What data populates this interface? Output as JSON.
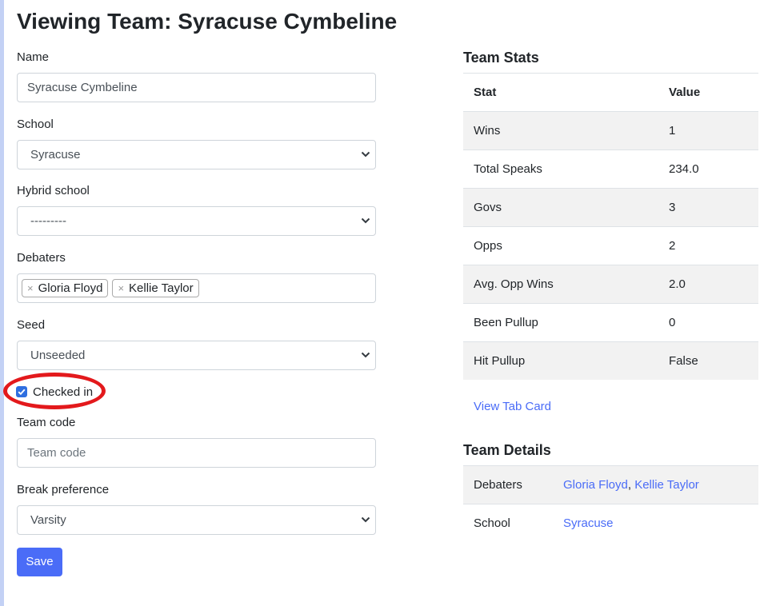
{
  "page": {
    "title": "Viewing Team: Syracuse Cymbeline"
  },
  "form": {
    "name": {
      "label": "Name",
      "value": "Syracuse Cymbeline"
    },
    "school": {
      "label": "School",
      "value": "Syracuse"
    },
    "hybrid_school": {
      "label": "Hybrid school",
      "value": "---------"
    },
    "debaters": {
      "label": "Debaters",
      "chips": [
        "Gloria Floyd",
        "Kellie Taylor"
      ],
      "remove_glyph": "×"
    },
    "seed": {
      "label": "Seed",
      "value": "Unseeded"
    },
    "checked_in": {
      "label": "Checked in",
      "checked": true
    },
    "team_code": {
      "label": "Team code",
      "value": "",
      "placeholder": "Team code"
    },
    "break_preference": {
      "label": "Break preference",
      "value": "Varsity"
    },
    "save_label": "Save"
  },
  "team_stats": {
    "title": "Team Stats",
    "headers": [
      "Stat",
      "Value"
    ],
    "rows": [
      {
        "stat": "Wins",
        "value": "1"
      },
      {
        "stat": "Total Speaks",
        "value": "234.0"
      },
      {
        "stat": "Govs",
        "value": "3"
      },
      {
        "stat": "Opps",
        "value": "2"
      },
      {
        "stat": "Avg. Opp Wins",
        "value": "2.0"
      },
      {
        "stat": "Been Pullup",
        "value": "0"
      },
      {
        "stat": "Hit Pullup",
        "value": "False"
      }
    ],
    "tab_card_link": "View Tab Card"
  },
  "team_details": {
    "title": "Team Details",
    "debaters_label": "Debaters",
    "debaters": [
      "Gloria Floyd",
      "Kellie Taylor"
    ],
    "separator": ",",
    "school_label": "School",
    "school": "Syracuse"
  },
  "colors": {
    "accent": "#4a6cf7",
    "annotation": "#e3191c",
    "stripe": "#f2f2f2",
    "left_rail": "#c3d1f5"
  },
  "icons": {
    "select": "chevron-down-icon",
    "checkbox": "checkmark-icon"
  }
}
